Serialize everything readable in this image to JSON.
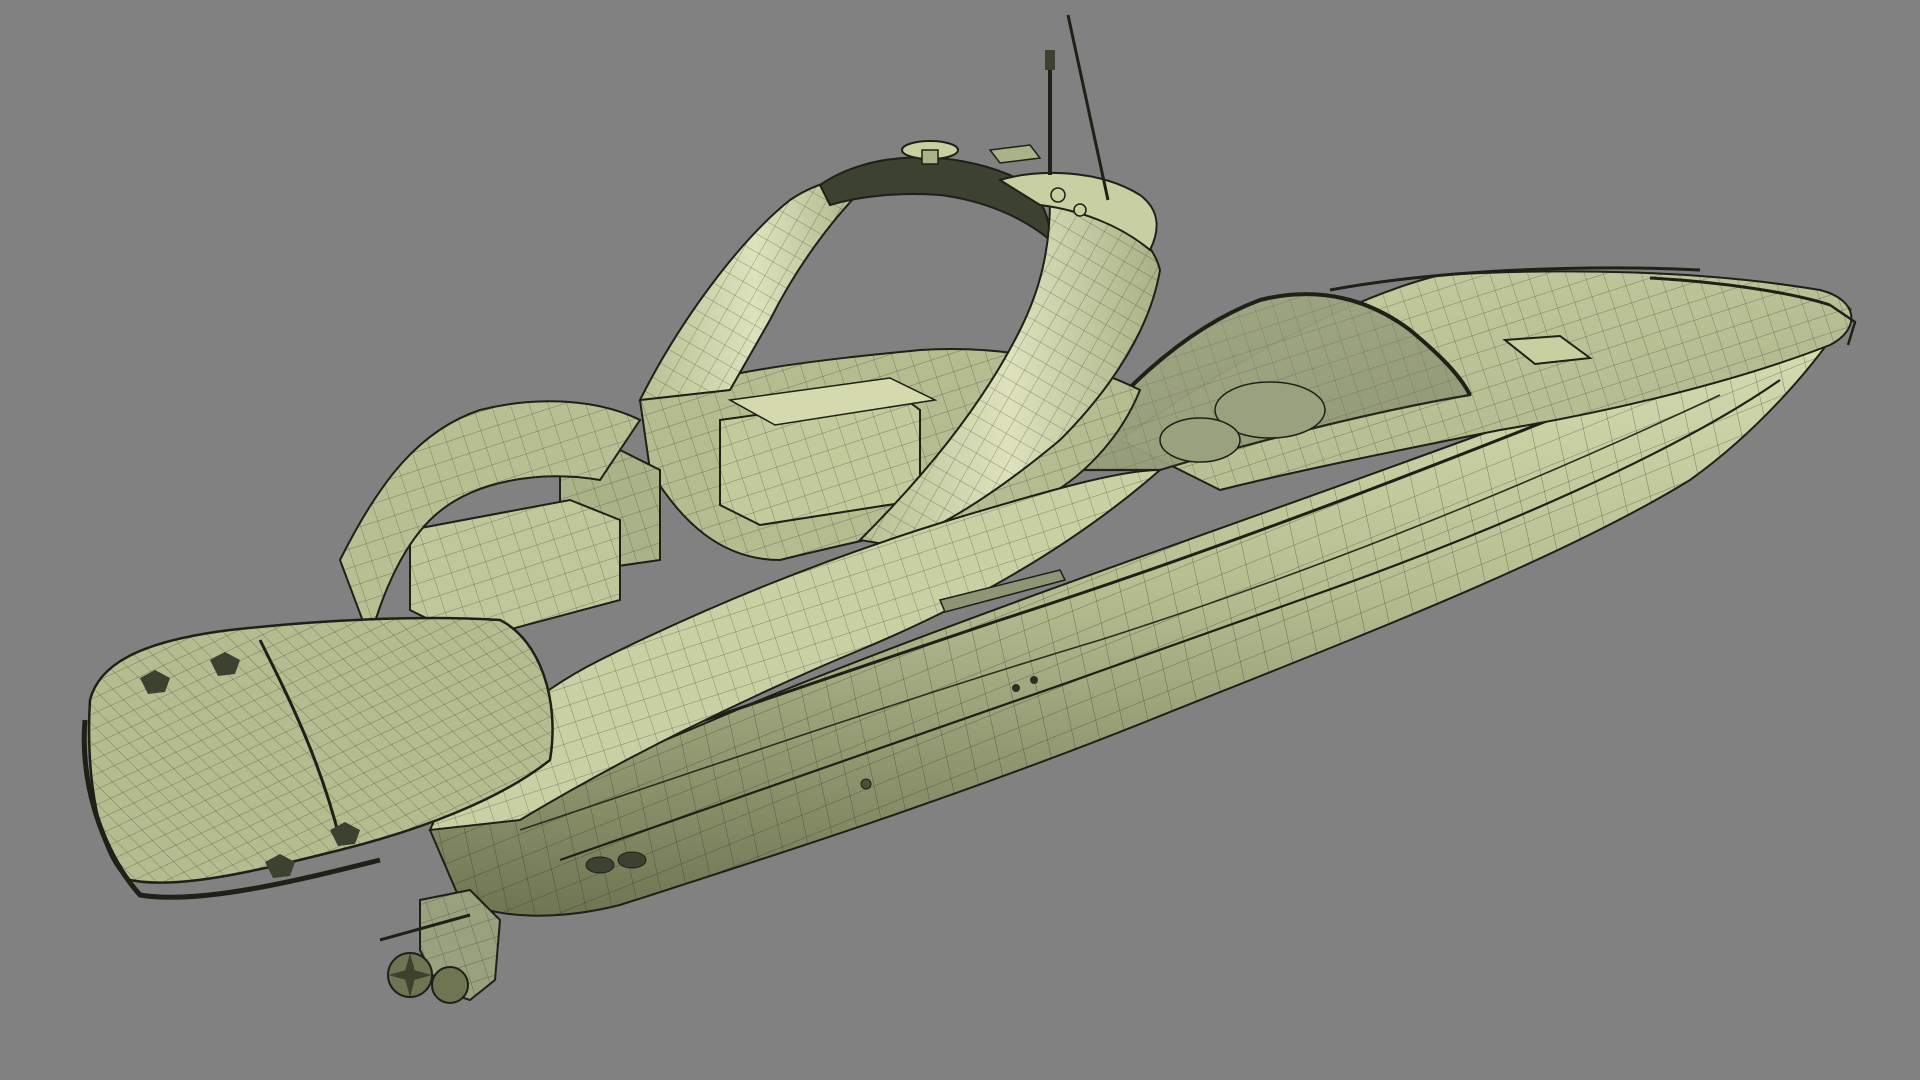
{
  "viewport": {
    "background_color": "#818181",
    "model_fill_light": "#d9dfb4",
    "model_fill_mid": "#aeb68a",
    "model_fill_dark": "#6f7552",
    "wire_color": "#1d2117",
    "subject": "speedboat-wireframe-model"
  }
}
